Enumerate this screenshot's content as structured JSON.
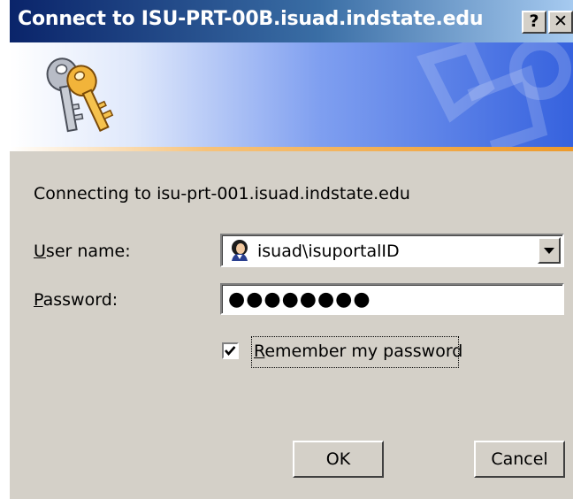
{
  "window": {
    "title": "Connect to ISU-PRT-00B.isuad.indstate.edu",
    "help_button": "?",
    "close_button": "✕"
  },
  "banner": {
    "icon": "keys-icon"
  },
  "message": "Connecting to isu-prt-001.isuad.indstate.edu",
  "username": {
    "label_accel": "U",
    "label_rest": "ser name:",
    "value": "isuad\\isuportalID",
    "icon": "user-avatar-icon"
  },
  "password": {
    "label_accel": "P",
    "label_rest": "assword:",
    "value": "●●●●●●●●"
  },
  "remember": {
    "checked": true,
    "label_accel": "R",
    "label_rest": "emember my password"
  },
  "buttons": {
    "ok": "OK",
    "cancel": "Cancel"
  }
}
